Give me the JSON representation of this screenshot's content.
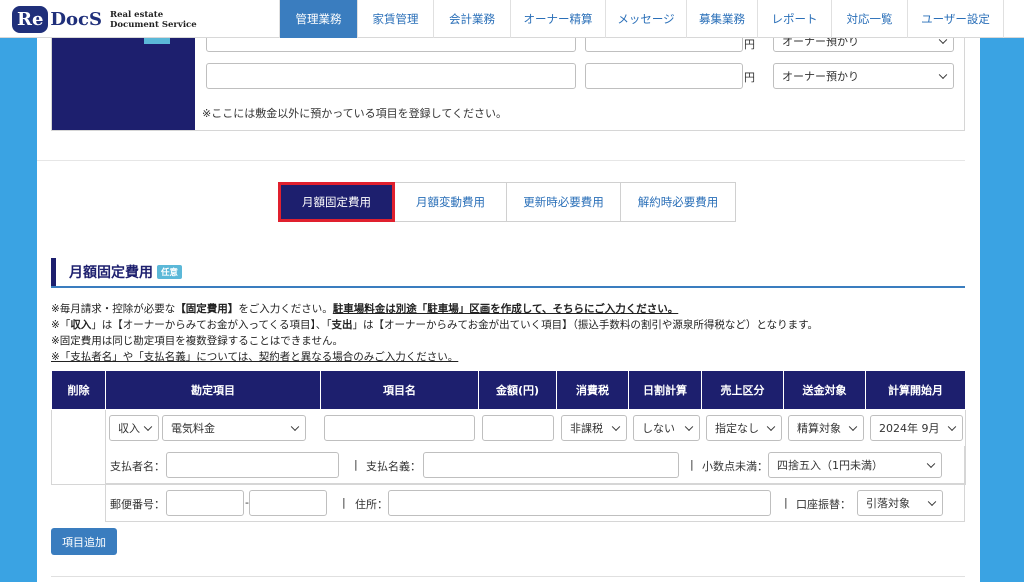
{
  "app": {
    "logo_re": "Re",
    "logo_docs": "DocS",
    "logo_sub_1": "Real estate",
    "logo_sub_2": "Document Service"
  },
  "nav": {
    "items": [
      "管理業務",
      "家賃管理",
      "会計業務",
      "オーナー精算",
      "メッセージ",
      "募集業務",
      "レポート",
      "対応一覧",
      "ユーザー設定"
    ],
    "active": "管理業務"
  },
  "deposit": {
    "yen_unit": "円",
    "holder_option": "オーナー預かり",
    "note": "※ここには敷金以外に預かっている項目を登録してください。"
  },
  "cost_tabs": [
    "月額固定費用",
    "月額変動費用",
    "更新時必要費用",
    "解約時必要費用"
  ],
  "section": {
    "title": "月額固定費用",
    "badge": "任意"
  },
  "notes": {
    "line1_a": "※毎月請求・控除が必要な",
    "line1_b": "【固定費用】",
    "line1_c": "をご入力ください。",
    "line1_d": "駐車場料金は別途「駐車場」区画を作成して、そちらにご入力ください。",
    "line2_a": "※「",
    "line2_b": "収入",
    "line2_c": "」は【オーナーからみてお金が入ってくる項目】、「",
    "line2_d": "支出",
    "line2_e": "」は【オーナーからみてお金が出ていく項目】（振込手数料の割引や源泉所得税など）となります。",
    "line3": "※固定費用は同じ勘定項目を複数登録することはできません。",
    "line4": "※「支払者名」や「支払名義」については、契約者と異なる場合のみご入力ください。"
  },
  "table": {
    "headers": [
      "削除",
      "勘定項目",
      "項目名",
      "金額(円)",
      "消費税",
      "日割計算",
      "売上区分",
      "送金対象",
      "計算開始月"
    ],
    "row": {
      "direction": "収入",
      "account": "電気料金",
      "item_name": "",
      "amount": "",
      "tax": "非課税",
      "prorate": "しない",
      "sales_class": "指定なし",
      "remit": "精算対象",
      "start_month": "2024年 9月",
      "payer_label": "支払者名：",
      "payer_value": "",
      "payee_label": "支払名義：",
      "payee_value": "",
      "rounding_label": "小数点未満：",
      "rounding_value": "四捨五入（1円未満）",
      "postal_label": "郵便番号：",
      "postal_sep": "-",
      "address_label": "住所：",
      "transfer_label": "口座振替：",
      "transfer_value": "引落対象",
      "pipe": "|"
    }
  },
  "buttons": {
    "add_item": "項目追加"
  }
}
